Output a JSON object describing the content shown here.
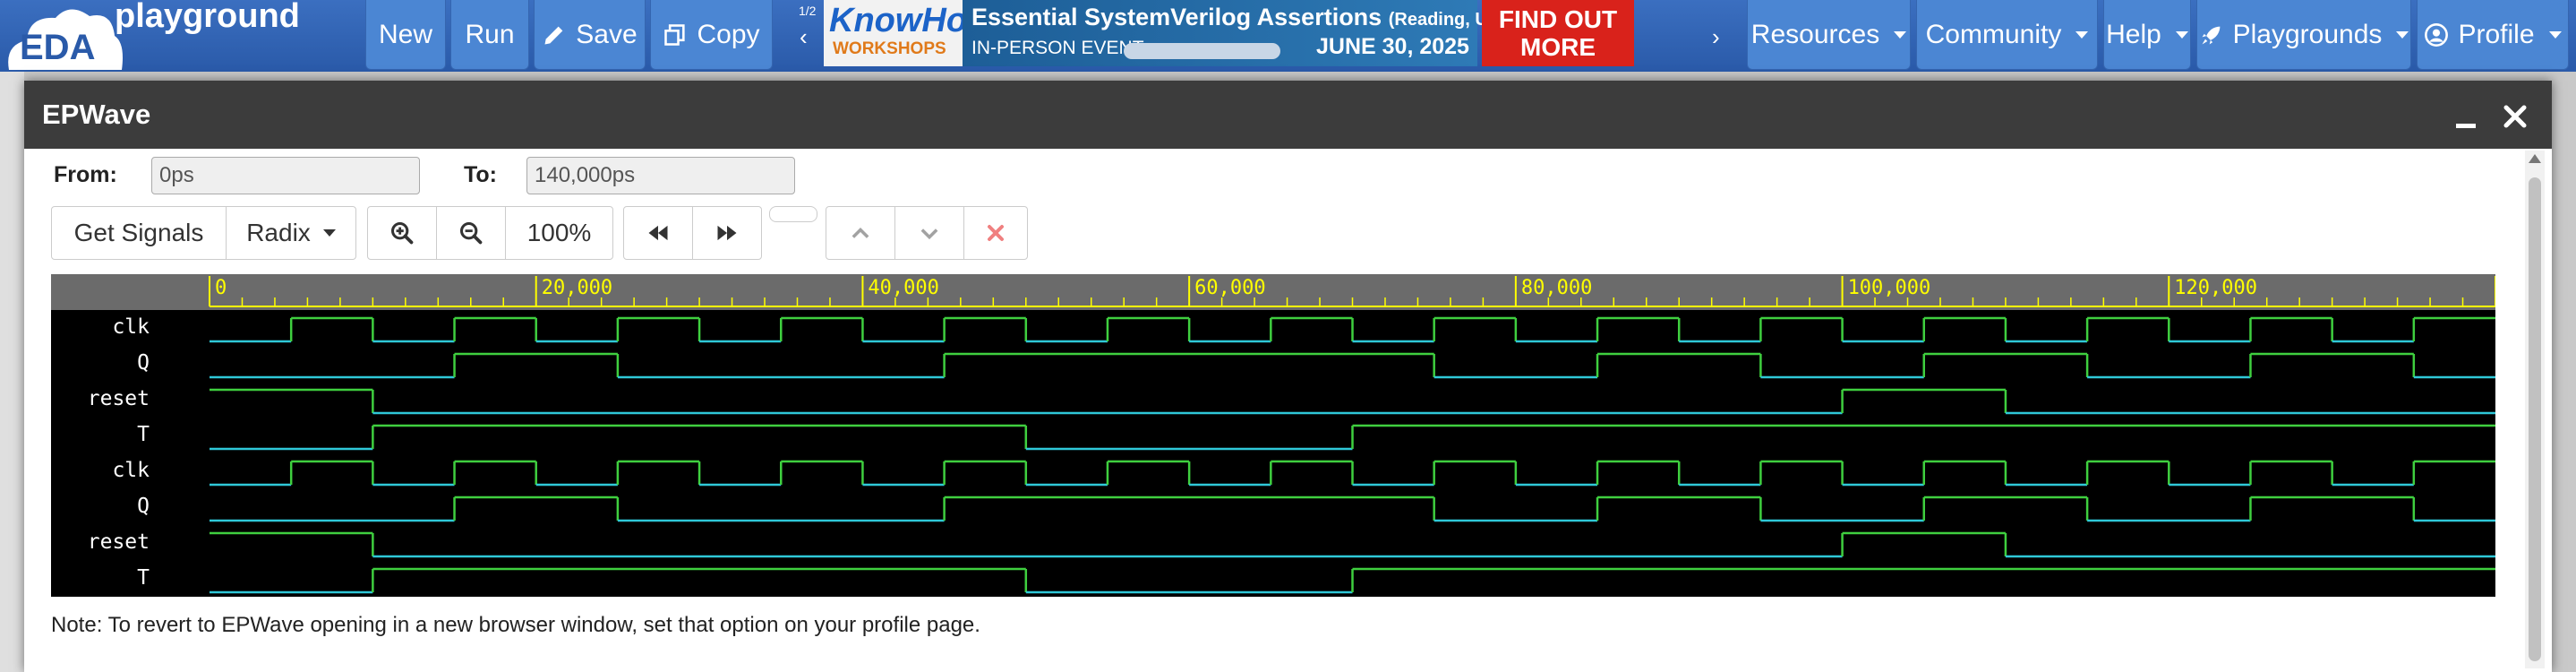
{
  "navbar": {
    "logo_text": "EDA",
    "brand_text": "playground",
    "new_label": "New",
    "run_label": "Run",
    "save_label": "Save",
    "copy_label": "Copy",
    "ad_counter": "1/2",
    "resources_label": "Resources",
    "community_label": "Community",
    "help_label": "Help",
    "playgrounds_label": "Playgrounds",
    "profile_label": "Profile"
  },
  "ad": {
    "brand_know": "KnowHow",
    "brand_workshops": "WORKSHOPS",
    "headline": "Essential SystemVerilog Assertions",
    "location": "(Reading, UK)",
    "event_type": "IN-PERSON EVENT",
    "date": "JUNE 30, 2025",
    "cta_line1": "FIND OUT",
    "cta_line2": "MORE"
  },
  "modal": {
    "title": "EPWave",
    "from_label": "From:",
    "from_value": "0ps",
    "to_label": "To:",
    "to_value": "140,000ps",
    "get_signals_label": "Get Signals",
    "radix_label": "Radix",
    "zoom_label": "100%",
    "note": "Note: To revert to EPWave opening in a new browser window, set that option on your profile page."
  },
  "waveform": {
    "time_end": 140000,
    "ruler_labels": [
      "0",
      "20,000",
      "40,000",
      "60,000",
      "80,000",
      "100,000",
      "120,000"
    ],
    "ruler_values": [
      0,
      20000,
      40000,
      60000,
      80000,
      100000,
      120000
    ],
    "signals": [
      {
        "name": "clk",
        "transitions": [
          [
            0,
            0
          ],
          [
            5000,
            1
          ],
          [
            10000,
            0
          ],
          [
            15000,
            1
          ],
          [
            20000,
            0
          ],
          [
            25000,
            1
          ],
          [
            30000,
            0
          ],
          [
            35000,
            1
          ],
          [
            40000,
            0
          ],
          [
            45000,
            1
          ],
          [
            50000,
            0
          ],
          [
            55000,
            1
          ],
          [
            60000,
            0
          ],
          [
            65000,
            1
          ],
          [
            70000,
            0
          ],
          [
            75000,
            1
          ],
          [
            80000,
            0
          ],
          [
            85000,
            1
          ],
          [
            90000,
            0
          ],
          [
            95000,
            1
          ],
          [
            100000,
            0
          ],
          [
            105000,
            1
          ],
          [
            110000,
            0
          ],
          [
            115000,
            1
          ],
          [
            120000,
            0
          ],
          [
            125000,
            1
          ],
          [
            130000,
            0
          ],
          [
            135000,
            1
          ]
        ]
      },
      {
        "name": "Q",
        "transitions": [
          [
            0,
            0
          ],
          [
            15000,
            1
          ],
          [
            25000,
            0
          ],
          [
            45000,
            1
          ],
          [
            75000,
            0
          ],
          [
            85000,
            1
          ],
          [
            95000,
            0
          ],
          [
            105000,
            1
          ],
          [
            115000,
            0
          ],
          [
            125000,
            1
          ],
          [
            135000,
            0
          ]
        ]
      },
      {
        "name": "reset",
        "transitions": [
          [
            0,
            1
          ],
          [
            10000,
            0
          ],
          [
            100000,
            1
          ],
          [
            110000,
            0
          ]
        ]
      },
      {
        "name": "T",
        "transitions": [
          [
            0,
            0
          ],
          [
            10000,
            1
          ],
          [
            50000,
            0
          ],
          [
            70000,
            1
          ]
        ]
      },
      {
        "name": "clk",
        "transitions": [
          [
            0,
            0
          ],
          [
            5000,
            1
          ],
          [
            10000,
            0
          ],
          [
            15000,
            1
          ],
          [
            20000,
            0
          ],
          [
            25000,
            1
          ],
          [
            30000,
            0
          ],
          [
            35000,
            1
          ],
          [
            40000,
            0
          ],
          [
            45000,
            1
          ],
          [
            50000,
            0
          ],
          [
            55000,
            1
          ],
          [
            60000,
            0
          ],
          [
            65000,
            1
          ],
          [
            70000,
            0
          ],
          [
            75000,
            1
          ],
          [
            80000,
            0
          ],
          [
            85000,
            1
          ],
          [
            90000,
            0
          ],
          [
            95000,
            1
          ],
          [
            100000,
            0
          ],
          [
            105000,
            1
          ],
          [
            110000,
            0
          ],
          [
            115000,
            1
          ],
          [
            120000,
            0
          ],
          [
            125000,
            1
          ],
          [
            130000,
            0
          ],
          [
            135000,
            1
          ]
        ]
      },
      {
        "name": "Q",
        "transitions": [
          [
            0,
            0
          ],
          [
            15000,
            1
          ],
          [
            25000,
            0
          ],
          [
            45000,
            1
          ],
          [
            75000,
            0
          ],
          [
            85000,
            1
          ],
          [
            95000,
            0
          ],
          [
            105000,
            1
          ],
          [
            115000,
            0
          ],
          [
            125000,
            1
          ],
          [
            135000,
            0
          ]
        ]
      },
      {
        "name": "reset",
        "transitions": [
          [
            0,
            1
          ],
          [
            10000,
            0
          ],
          [
            100000,
            1
          ],
          [
            110000,
            0
          ]
        ]
      },
      {
        "name": "T",
        "transitions": [
          [
            0,
            0
          ],
          [
            10000,
            1
          ],
          [
            50000,
            0
          ],
          [
            70000,
            1
          ]
        ]
      }
    ]
  },
  "colors": {
    "wave_high": "#3fcf3f",
    "wave_low": "#2fc8d8",
    "ruler_bg": "#6b6b6b",
    "ruler_text": "#ffff00",
    "navbar": "#2f63b3"
  },
  "icons": [
    "pencil-icon",
    "copy-icon",
    "rocket-icon",
    "user-circle-icon",
    "zoom-in-icon",
    "zoom-out-icon",
    "rewind-icon",
    "fast-forward-icon",
    "chevron-up-icon",
    "chevron-down-icon",
    "close-x-icon",
    "minimize-icon",
    "close-icon"
  ]
}
